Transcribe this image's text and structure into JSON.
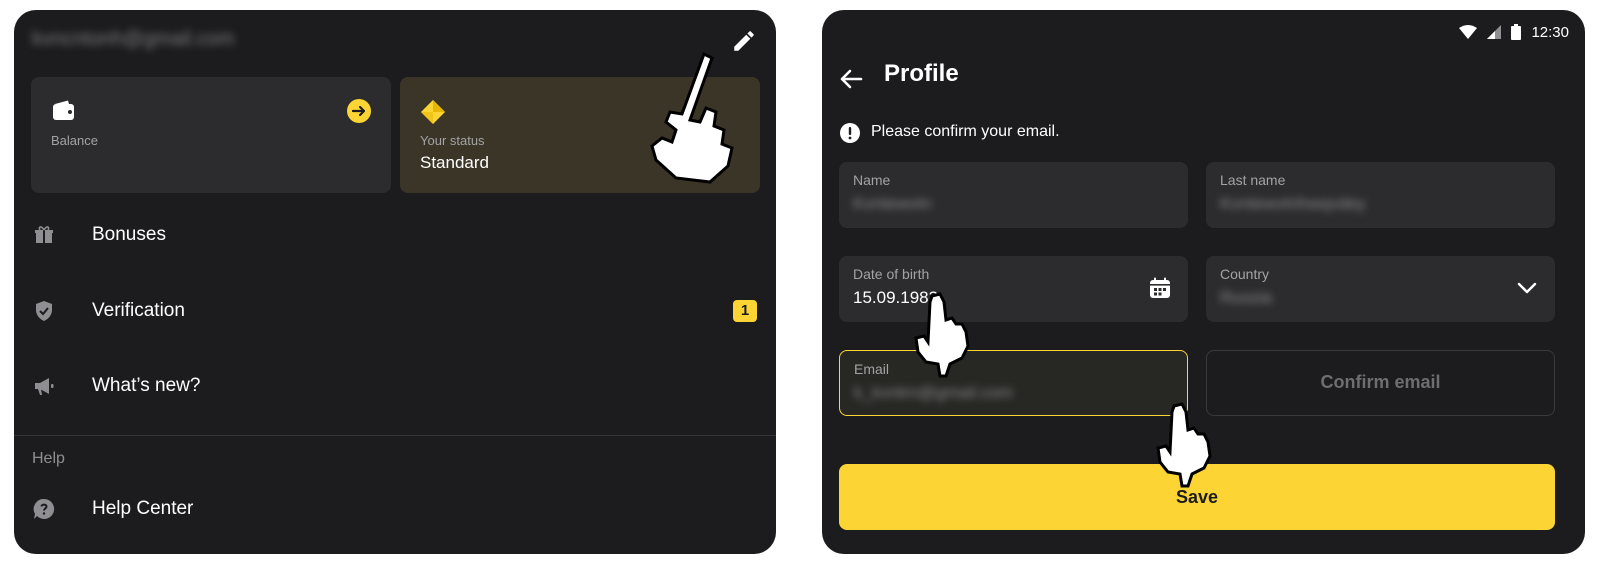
{
  "left": {
    "account_email": "kvncntonh@gmail.com",
    "balance": {
      "label": "Balance",
      "icon": "wallet-icon",
      "action_icon": "arrow-right-icon"
    },
    "status": {
      "label": "Your status",
      "value": "Standard",
      "icon": "diamond-icon"
    },
    "menu": [
      {
        "label": "Bonuses",
        "icon": "gift-icon"
      },
      {
        "label": "Verification",
        "icon": "shield-check-icon",
        "badge": "1"
      },
      {
        "label": "What’s new?",
        "icon": "megaphone-icon"
      }
    ],
    "help_section": {
      "label": "Help",
      "items": [
        {
          "label": "Help Center",
          "icon": "help-bubble-icon"
        }
      ]
    }
  },
  "right": {
    "status_bar": {
      "time": "12:30",
      "icons": [
        "wifi-icon",
        "signal-icon",
        "battery-icon"
      ]
    },
    "title": "Profile",
    "notice": "Please confirm your email.",
    "fields": {
      "name": {
        "label": "Name",
        "value": "Kvntewvtn"
      },
      "last_name": {
        "label": "Last name",
        "value": "Kvntewvtnhwqvdey"
      },
      "dob": {
        "label": "Date of birth",
        "value": "15.09.1983"
      },
      "country": {
        "label": "Country",
        "value": "Russia"
      },
      "email": {
        "label": "Email",
        "value": "k_kvntrn@gmail.com"
      }
    },
    "confirm_email_label": "Confirm email",
    "save_label": "Save"
  },
  "colors": {
    "panel_bg": "#1c1c1e",
    "card_bg": "#2c2c2e",
    "accent": "#fcd535",
    "status_card_bg": "#3a3527"
  }
}
